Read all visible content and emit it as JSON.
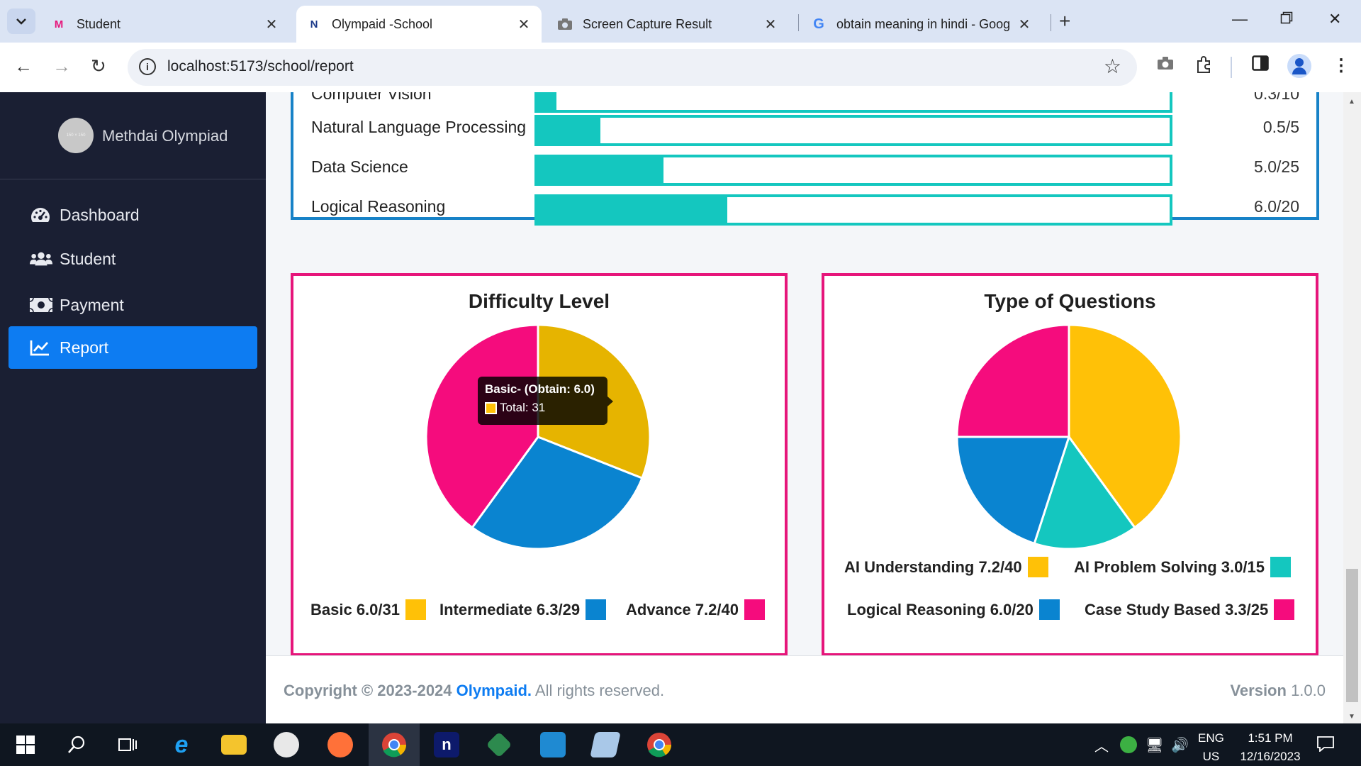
{
  "browser": {
    "tabs": [
      {
        "title": "Student",
        "favicon": "M"
      },
      {
        "title": "Olympaid -School",
        "favicon": "N"
      },
      {
        "title": "Screen Capture Result",
        "favicon": "camera"
      },
      {
        "title": "obtain meaning in hindi - Goog",
        "favicon": "G"
      }
    ],
    "url": "localhost:5173/school/report"
  },
  "sidebar": {
    "brand": "Methdai Olympiad",
    "logo_text": "150 × 150",
    "items": [
      {
        "label": "Dashboard",
        "icon": "tachometer-icon"
      },
      {
        "label": "Student",
        "icon": "users-icon"
      },
      {
        "label": "Payment",
        "icon": "money-bill-icon"
      },
      {
        "label": "Report",
        "icon": "chart-line-icon",
        "active": true
      }
    ]
  },
  "subjects": [
    {
      "name": "Computer Vision",
      "score": "0.3/10",
      "fraction": 0.03
    },
    {
      "name": "Natural Language Processing",
      "score": "0.5/5",
      "fraction": 0.1
    },
    {
      "name": "Data Science",
      "score": "5.0/25",
      "fraction": 0.2
    },
    {
      "name": "Logical Reasoning",
      "score": "6.0/20",
      "fraction": 0.3
    }
  ],
  "difficulty": {
    "title": "Difficulty Level",
    "tooltip": {
      "title": "Basic- (Obtain: 6.0)",
      "body": "Total: 31"
    },
    "legend": [
      {
        "label": "Basic 6.0/31",
        "color": "#ffc107"
      },
      {
        "label": "Intermediate 6.3/29",
        "color": "#0a84d0"
      },
      {
        "label": "Advance 7.2/40",
        "color": "#f50c7d"
      }
    ]
  },
  "question_types": {
    "title": "Type of Questions",
    "legend": [
      {
        "label": "AI Understanding  7.2/40",
        "color": "#ffc107"
      },
      {
        "label": "AI Problem Solving 3.0/15",
        "color": "#14c7bf"
      },
      {
        "label": "Logical Reasoning 6.0/20",
        "color": "#0a84d0"
      },
      {
        "label": "Case Study Based 3.3/25",
        "color": "#f50c7d"
      }
    ]
  },
  "chart_data": [
    {
      "type": "pie",
      "title": "Difficulty Level",
      "categories": [
        "Basic",
        "Intermediate",
        "Advance"
      ],
      "values": [
        31,
        29,
        40
      ],
      "obtained": [
        6.0,
        6.3,
        7.2
      ],
      "colors": [
        "#ffc107",
        "#0a84d0",
        "#f50c7d"
      ],
      "highlighted": "Basic",
      "legend_position": "bottom"
    },
    {
      "type": "pie",
      "title": "Type of Questions",
      "categories": [
        "AI Understanding",
        "AI Problem Solving",
        "Logical Reasoning",
        "Case Study Based"
      ],
      "values": [
        40,
        15,
        20,
        25
      ],
      "obtained": [
        7.2,
        3.0,
        6.0,
        3.3
      ],
      "colors": [
        "#ffc107",
        "#14c7bf",
        "#0a84d0",
        "#f50c7d"
      ],
      "legend_position": "bottom"
    }
  ],
  "footer": {
    "copyright_prefix": "Copyright © 2023-2024 ",
    "brand": "Olympaid.",
    "suffix": " All rights reserved.",
    "version_label": "Version",
    "version_value": "1.0.0"
  },
  "taskbar": {
    "lang_top": "ENG",
    "lang_bottom": "US",
    "time": "1:51 PM",
    "date": "12/16/2023"
  }
}
